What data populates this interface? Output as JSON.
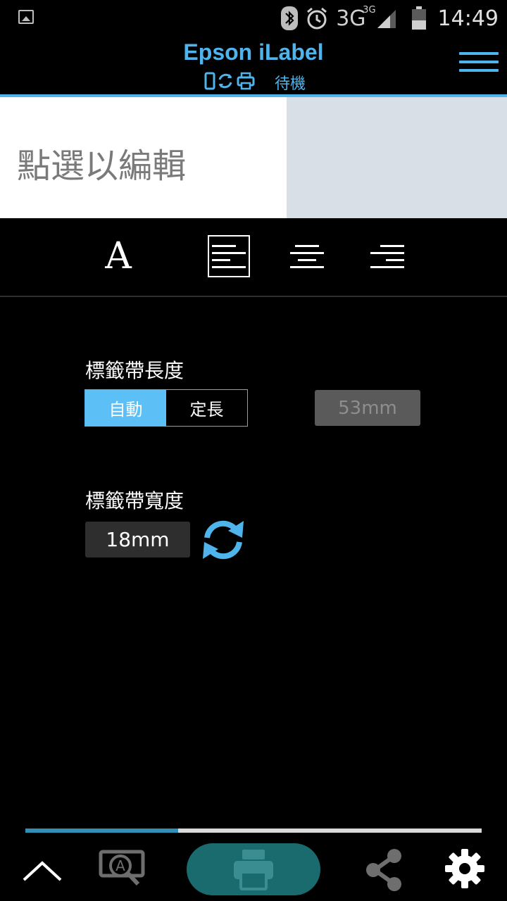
{
  "status_bar": {
    "network": "3G",
    "network_sup": "3G",
    "time": "14:49"
  },
  "header": {
    "title": "Epson iLabel",
    "status_text": "待機",
    "accent_color": "#4fb4ec"
  },
  "preview": {
    "placeholder": "點選以編輯"
  },
  "toolbar": {
    "font_glyph": "A"
  },
  "tape_length": {
    "label": "標籤帶長度",
    "options": [
      "自動",
      "定長"
    ],
    "selected": "自動",
    "value": "53mm"
  },
  "tape_width": {
    "label": "標籤帶寬度",
    "value": "18mm"
  },
  "progress": {
    "fraction": 0.335
  },
  "icons": {
    "gallery": "image-icon",
    "bluetooth": "bluetooth-icon",
    "alarm": "alarm-icon",
    "signal": "signal-icon",
    "battery": "battery-icon",
    "menu": "hamburger-menu-icon",
    "up": "chevron-up-icon",
    "preview": "print-preview-icon",
    "print": "printer-icon",
    "share": "share-icon",
    "settings": "gear-icon",
    "refresh": "refresh-icon"
  }
}
